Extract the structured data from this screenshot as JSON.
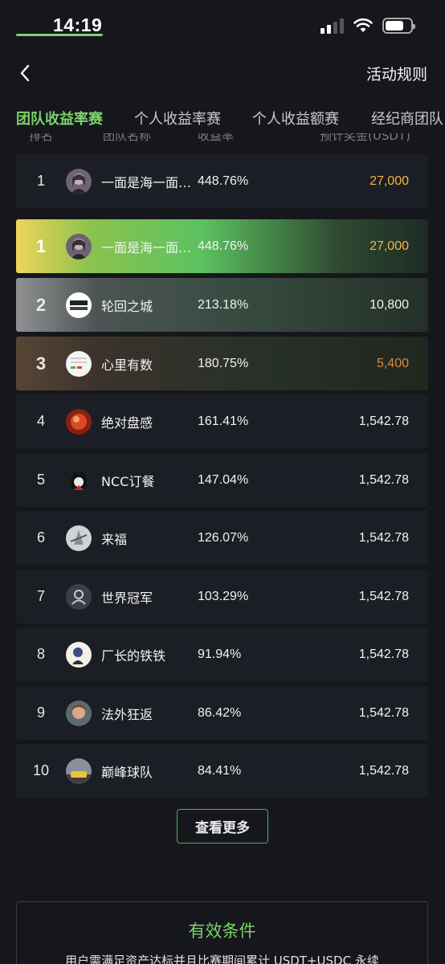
{
  "status": {
    "time": "14:19"
  },
  "nav": {
    "rules_label": "活动规则"
  },
  "tabs": [
    "团队收益率赛",
    "个人收益率赛",
    "个人收益额赛",
    "经纪商团队"
  ],
  "table_head": {
    "rank": "排名",
    "team": "团队名称",
    "rate": "收益率",
    "prize": "预计奖金(USDT)"
  },
  "my_row": {
    "rank": "1",
    "name": "一面是海一面…",
    "rate": "448.76%",
    "prize": "27,000"
  },
  "rows": [
    {
      "rank": "1",
      "name": "一面是海一面…",
      "rate": "448.76%",
      "prize": "27,000"
    },
    {
      "rank": "2",
      "name": "轮回之城",
      "rate": "213.18%",
      "prize": "10,800"
    },
    {
      "rank": "3",
      "name": "心里有数",
      "rate": "180.75%",
      "prize": "5,400"
    },
    {
      "rank": "4",
      "name": "绝对盘感",
      "rate": "161.41%",
      "prize": "1,542.78"
    },
    {
      "rank": "5",
      "name": "NCC订餐",
      "rate": "147.04%",
      "prize": "1,542.78"
    },
    {
      "rank": "6",
      "name": "来福",
      "rate": "126.07%",
      "prize": "1,542.78"
    },
    {
      "rank": "7",
      "name": "世界冠军",
      "rate": "103.29%",
      "prize": "1,542.78"
    },
    {
      "rank": "8",
      "name": "厂长的铁铁",
      "rate": "91.94%",
      "prize": "1,542.78"
    },
    {
      "rank": "9",
      "name": "法外狂返",
      "rate": "86.42%",
      "prize": "1,542.78"
    },
    {
      "rank": "10",
      "name": "巅峰球队",
      "rate": "84.41%",
      "prize": "1,542.78"
    }
  ],
  "more_label": "查看更多",
  "conditions": {
    "title": "有效条件",
    "text": "用户需满足资产达标并且比赛期间累计 USDT+USDC 永续"
  },
  "colors": {
    "accent": "#7bd36b",
    "gold": "#f3b43f",
    "bronze": "#d9893f",
    "background": "#16171c",
    "row": "#1c1e25"
  }
}
